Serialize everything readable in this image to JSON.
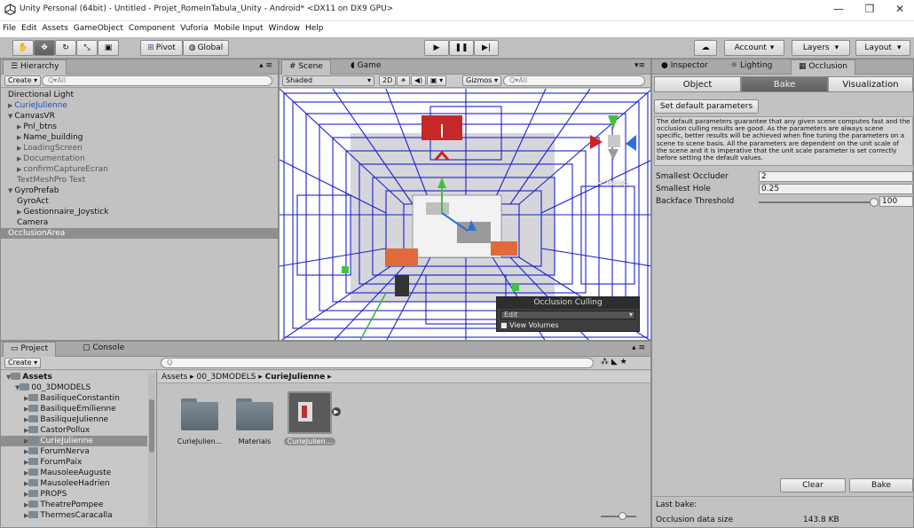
{
  "window": {
    "title": "Unity Personal (64bit) - Untitled - Projet_RomeInTabula_Unity - Android* <DX11 on DX9 GPU>",
    "minimize": "—",
    "maximize": "❐",
    "close": "✕"
  },
  "menu": [
    "File",
    "Edit",
    "Assets",
    "GameObject",
    "Component",
    "Vuforia",
    "Mobile Input",
    "Window",
    "Help"
  ],
  "toolbar": {
    "pivot": "Pivot",
    "global": "Global",
    "account": "Account",
    "layers": "Layers",
    "layout": "Layout"
  },
  "hierarchy": {
    "tab": "Hierarchy",
    "create": "Create",
    "search_placeholder": "Q▾All",
    "items": [
      {
        "label": "Directional Light",
        "indent": 0,
        "arrow": "",
        "color": "#111",
        "selected": false
      },
      {
        "label": "CurieJulienne",
        "indent": 0,
        "arrow": "▶",
        "color": "#1b4fbd",
        "selected": false
      },
      {
        "label": "CanvasVR",
        "indent": 0,
        "arrow": "▼",
        "color": "#111",
        "selected": false
      },
      {
        "label": "Pnl_btns",
        "indent": 1,
        "arrow": "▶",
        "color": "#111",
        "selected": false
      },
      {
        "label": "Name_building",
        "indent": 1,
        "arrow": "▶",
        "color": "#111",
        "selected": false
      },
      {
        "label": "LoadingScreen",
        "indent": 1,
        "arrow": "▶",
        "color": "#555",
        "selected": false
      },
      {
        "label": "Documentation",
        "indent": 1,
        "arrow": "▶",
        "color": "#555",
        "selected": false
      },
      {
        "label": "confirmCaptureEcran",
        "indent": 1,
        "arrow": "▶",
        "color": "#555",
        "selected": false
      },
      {
        "label": "TextMeshPro Text",
        "indent": 1,
        "arrow": "",
        "color": "#555",
        "selected": false
      },
      {
        "label": "GyroPrefab",
        "indent": 0,
        "arrow": "▼",
        "color": "#111",
        "selected": false
      },
      {
        "label": "GyroAct",
        "indent": 1,
        "arrow": "",
        "color": "#111",
        "selected": false
      },
      {
        "label": "Gestionnaire_Joystick",
        "indent": 1,
        "arrow": "▶",
        "color": "#111",
        "selected": false
      },
      {
        "label": "Camera",
        "indent": 1,
        "arrow": "",
        "color": "#111",
        "selected": false
      },
      {
        "label": "OcclusionArea",
        "indent": 0,
        "arrow": "",
        "color": "#fff",
        "selected": true
      }
    ]
  },
  "scene": {
    "tab_scene": "Scene",
    "tab_game": "Game",
    "shaded": "Shaded",
    "mode_2d": "2D",
    "gizmos": "Gizmos",
    "search_placeholder": "Q▾All",
    "persp": "< Persp",
    "occlusion_overlay": {
      "title": "Occlusion Culling",
      "mode": "Edit",
      "view_volumes": "View Volumes"
    }
  },
  "project": {
    "tab_project": "Project",
    "tab_console": "Console",
    "create": "Create",
    "search_placeholder": "Q",
    "tree": [
      {
        "label": "Assets",
        "indent": 0,
        "arrow": "▼",
        "bold": true,
        "selected": false
      },
      {
        "label": "00_3DMODELS",
        "indent": 1,
        "arrow": "▼",
        "bold": false,
        "selected": false
      },
      {
        "label": "BasiliqueConstantin",
        "indent": 2,
        "arrow": "▶",
        "bold": false,
        "selected": false
      },
      {
        "label": "BasiliqueEmilienne",
        "indent": 2,
        "arrow": "▶",
        "bold": false,
        "selected": false
      },
      {
        "label": "BasiliqueJulienne",
        "indent": 2,
        "arrow": "▶",
        "bold": false,
        "selected": false
      },
      {
        "label": "CastorPollux",
        "indent": 2,
        "arrow": "▶",
        "bold": false,
        "selected": false
      },
      {
        "label": "CurieJulienne",
        "indent": 2,
        "arrow": "▶",
        "bold": false,
        "selected": true
      },
      {
        "label": "ForumNerva",
        "indent": 2,
        "arrow": "▶",
        "bold": false,
        "selected": false
      },
      {
        "label": "ForumPaix",
        "indent": 2,
        "arrow": "▶",
        "bold": false,
        "selected": false
      },
      {
        "label": "MausoleeAuguste",
        "indent": 2,
        "arrow": "▶",
        "bold": false,
        "selected": false
      },
      {
        "label": "MausoleeHadrien",
        "indent": 2,
        "arrow": "▶",
        "bold": false,
        "selected": false
      },
      {
        "label": "PROPS",
        "indent": 2,
        "arrow": "▶",
        "bold": false,
        "selected": false
      },
      {
        "label": "TheatrePompee",
        "indent": 2,
        "arrow": "▶",
        "bold": false,
        "selected": false
      },
      {
        "label": "ThermesCaracalla",
        "indent": 2,
        "arrow": "▶",
        "bold": false,
        "selected": false
      }
    ],
    "breadcrumb": [
      "Assets",
      "00_3DMODELS",
      "CurieJulienne"
    ],
    "assets": [
      {
        "label": "CurieJulien...",
        "kind": "folder",
        "selected": false
      },
      {
        "label": "Materials",
        "kind": "folder",
        "selected": false
      },
      {
        "label": "CurieJulien...",
        "kind": "model",
        "selected": true
      }
    ]
  },
  "inspector": {
    "tab_inspector": "Inspector",
    "tab_lighting": "Lighting",
    "tab_occlusion": "Occlusion",
    "btn_object": "Object",
    "btn_bake": "Bake",
    "btn_visualization": "Visualization",
    "set_default": "Set default parameters",
    "description": "The default parameters guarantee that any given scene computes fast and the occlusion culling results are good. As the parameters are always scene specific, better results will be achieved when fine tuning the parameters on a scene to scene basis. All the parameters are dependent on the unit scale of the scene and it is imperative that the unit scale parameter is set correctly before setting the default values.",
    "smallest_occluder_label": "Smallest Occluder",
    "smallest_occluder_value": "2",
    "smallest_hole_label": "Smallest Hole",
    "smallest_hole_value": "0.25",
    "backface_label": "Backface Threshold",
    "backface_value": "100",
    "backface_fraction": 1.0,
    "clear": "Clear",
    "bake": "Bake",
    "last_bake": "Last bake:",
    "occlusion_size_label": "Occlusion data size",
    "occlusion_size_value": "143.8 KB"
  }
}
